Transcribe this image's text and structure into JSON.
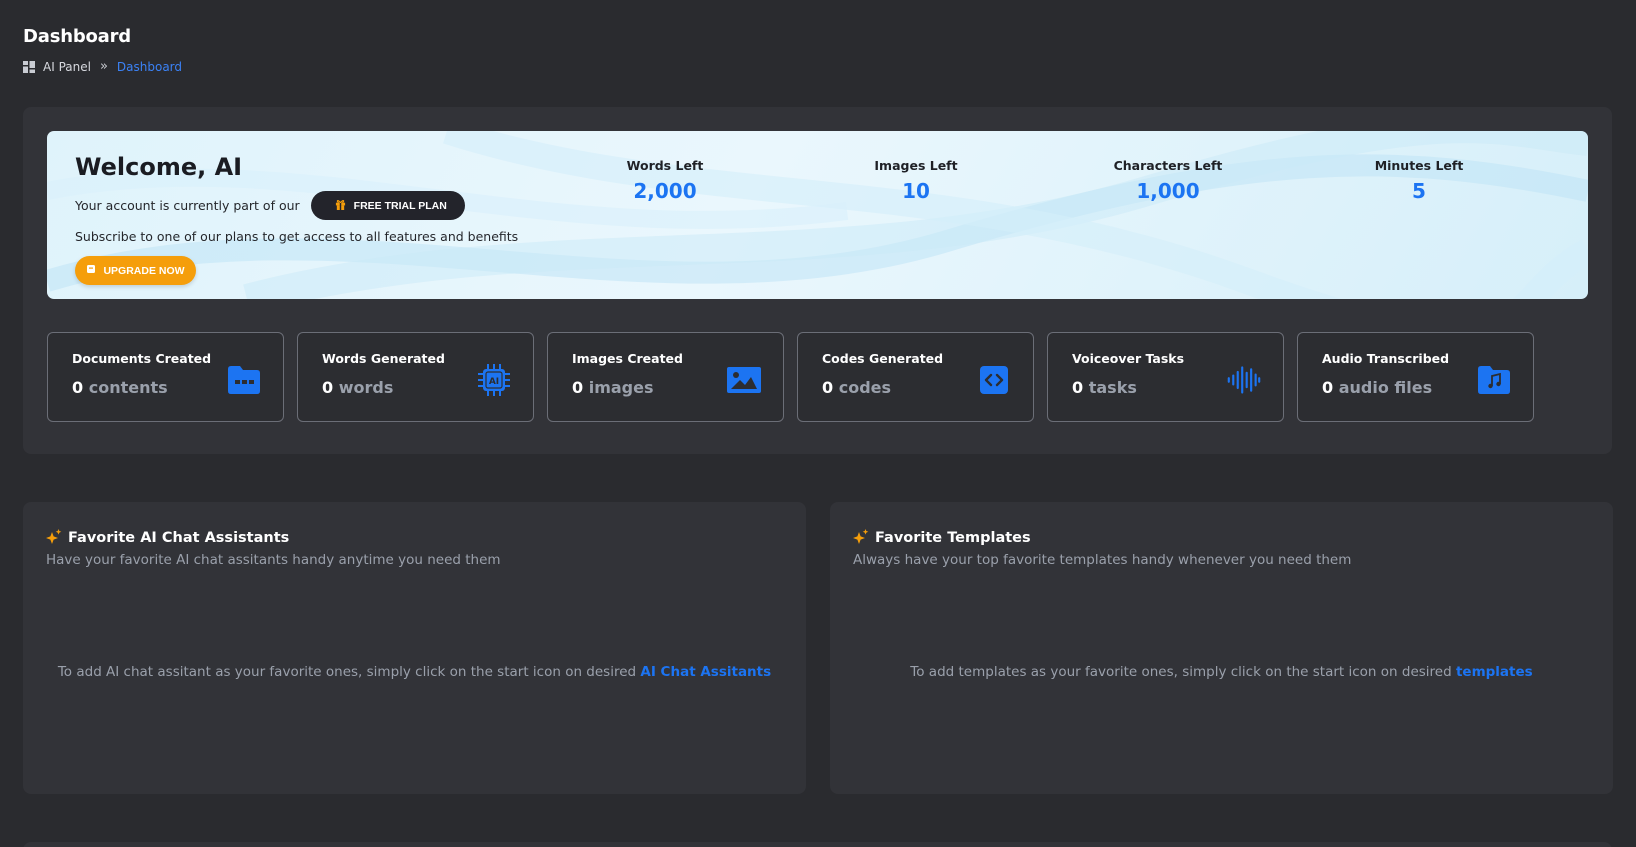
{
  "header": {
    "title": "Dashboard",
    "breadcrumb": {
      "root": "AI Panel",
      "separator": "»",
      "current": "Dashboard"
    }
  },
  "banner": {
    "greeting": "Welcome, AI",
    "plan_text": "Your account is currently part of our",
    "plan_button": "FREE TRIAL PLAN",
    "subscribe_text": "Subscribe to one of our plans to get access to all features and benefits",
    "upgrade_button": "UPGRADE NOW",
    "stats": [
      {
        "label": "Words Left",
        "value": "2,000"
      },
      {
        "label": "Images Left",
        "value": "10"
      },
      {
        "label": "Characters Left",
        "value": "1,000"
      },
      {
        "label": "Minutes Left",
        "value": "5"
      }
    ]
  },
  "cards": [
    {
      "label": "Documents Created",
      "count": "0",
      "unit": "contents",
      "icon": "folder-icon"
    },
    {
      "label": "Words Generated",
      "count": "0",
      "unit": "words",
      "icon": "ai-chip-icon"
    },
    {
      "label": "Images Created",
      "count": "0",
      "unit": "images",
      "icon": "image-icon"
    },
    {
      "label": "Codes Generated",
      "count": "0",
      "unit": "codes",
      "icon": "code-icon"
    },
    {
      "label": "Voiceover Tasks",
      "count": "0",
      "unit": "tasks",
      "icon": "waveform-icon"
    },
    {
      "label": "Audio Transcribed",
      "count": "0",
      "unit": "audio files",
      "icon": "music-folder-icon"
    }
  ],
  "favorites": {
    "assistants": {
      "title": "Favorite AI Chat Assistants",
      "subtitle": "Have your favorite AI chat assitants handy anytime you need them",
      "empty_text": "To add AI chat assitant as your favorite ones, simply click on the start icon on desired",
      "link": "AI Chat Assitants"
    },
    "templates": {
      "title": "Favorite Templates",
      "subtitle": "Always have your top favorite templates handy whenever you need them",
      "empty_text": "To add templates as your favorite ones, simply click on the start icon on desired",
      "link": "templates"
    }
  },
  "colors": {
    "background": "#2a2b2f",
    "panel": "#323338",
    "accent_blue": "#1c74f2",
    "accent_orange": "#f59e0b"
  }
}
